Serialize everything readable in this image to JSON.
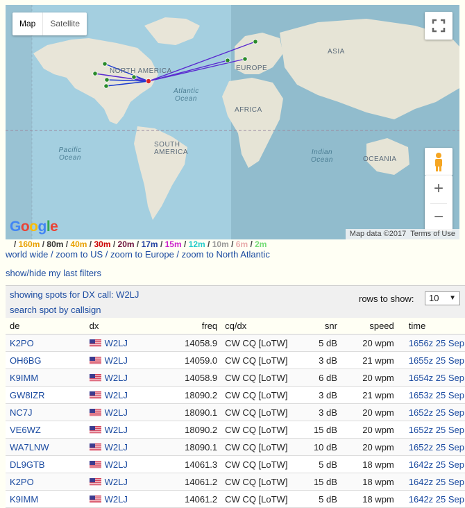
{
  "map": {
    "type_map": "Map",
    "type_satellite": "Satellite",
    "labels": {
      "north_america": "NORTH AMERICA",
      "south_america": "SOUTH AMERICA",
      "europe": "EUROPE",
      "asia": "ASIA",
      "africa": "AFRICA",
      "oceania": "OCEANIA",
      "atlantic": "Atlantic Ocean",
      "pacific": "Pacific Ocean",
      "indian": "Indian Ocean"
    },
    "logo": "Google",
    "map_data": "Map data ©2017",
    "terms": "Terms of Use",
    "zoom_in": "+",
    "zoom_out": "−",
    "icons": [
      "fullscreen-icon",
      "pegman-icon"
    ],
    "colors": {
      "land": "#e8e5d8",
      "water": "#a4cfe0",
      "dx_marker": "#d22",
      "spot_marker": "#2a8a2a"
    }
  },
  "bands": [
    {
      "label": "160m",
      "color": "#e8a000"
    },
    {
      "label": "80m",
      "color": "#333333"
    },
    {
      "label": "40m",
      "color": "#e8a000"
    },
    {
      "label": "30m",
      "color": "#cc0000"
    },
    {
      "label": "20m",
      "color": "#6a0e3a"
    },
    {
      "label": "17m",
      "color": "#1f3fa0"
    },
    {
      "label": "15m",
      "color": "#cc22cc"
    },
    {
      "label": "12m",
      "color": "#22cccc"
    },
    {
      "label": "10m",
      "color": "#999999"
    },
    {
      "label": "6m",
      "color": "#e8aaaa"
    },
    {
      "label": "2m",
      "color": "#77dd77"
    }
  ],
  "links": {
    "world_wide": "world wide",
    "zoom_us": "zoom to US",
    "zoom_europe": "zoom to Europe",
    "zoom_na": "zoom to North Atlantic",
    "sep": " / "
  },
  "filters": "show/hide my last filters",
  "panel": {
    "showing": "showing spots for DX call: W2LJ",
    "search": "search spot by callsign",
    "rows_label": "rows to show:",
    "rows_value": "10"
  },
  "table": {
    "headers": {
      "de": "de",
      "dx": "dx",
      "freq": "freq",
      "cq": "cq/dx",
      "snr": "snr",
      "speed": "speed",
      "time": "time"
    },
    "rows": [
      {
        "de": "K2PO",
        "dx": "W2LJ",
        "freq": "14058.9",
        "cq": "CW CQ [LoTW]",
        "snr": "5 dB",
        "speed": "20 wpm",
        "time": "1656z 25 Sep"
      },
      {
        "de": "OH6BG",
        "dx": "W2LJ",
        "freq": "14059.0",
        "cq": "CW CQ [LoTW]",
        "snr": "3 dB",
        "speed": "21 wpm",
        "time": "1655z 25 Sep"
      },
      {
        "de": "K9IMM",
        "dx": "W2LJ",
        "freq": "14058.9",
        "cq": "CW CQ [LoTW]",
        "snr": "6 dB",
        "speed": "20 wpm",
        "time": "1654z 25 Sep"
      },
      {
        "de": "GW8IZR",
        "dx": "W2LJ",
        "freq": "18090.2",
        "cq": "CW CQ [LoTW]",
        "snr": "3 dB",
        "speed": "21 wpm",
        "time": "1653z 25 Sep"
      },
      {
        "de": "NC7J",
        "dx": "W2LJ",
        "freq": "18090.1",
        "cq": "CW CQ [LoTW]",
        "snr": "3 dB",
        "speed": "20 wpm",
        "time": "1652z 25 Sep"
      },
      {
        "de": "VE6WZ",
        "dx": "W2LJ",
        "freq": "18090.2",
        "cq": "CW CQ [LoTW]",
        "snr": "15 dB",
        "speed": "20 wpm",
        "time": "1652z 25 Sep"
      },
      {
        "de": "WA7LNW",
        "dx": "W2LJ",
        "freq": "18090.1",
        "cq": "CW CQ [LoTW]",
        "snr": "10 dB",
        "speed": "20 wpm",
        "time": "1652z 25 Sep"
      },
      {
        "de": "DL9GTB",
        "dx": "W2LJ",
        "freq": "14061.3",
        "cq": "CW CQ [LoTW]",
        "snr": "5 dB",
        "speed": "18 wpm",
        "time": "1642z 25 Sep"
      },
      {
        "de": "K2PO",
        "dx": "W2LJ",
        "freq": "14061.2",
        "cq": "CW CQ [LoTW]",
        "snr": "15 dB",
        "speed": "18 wpm",
        "time": "1642z 25 Sep"
      },
      {
        "de": "K9IMM",
        "dx": "W2LJ",
        "freq": "14061.2",
        "cq": "CW CQ [LoTW]",
        "snr": "5 dB",
        "speed": "18 wpm",
        "time": "1642z 25 Sep"
      }
    ]
  }
}
